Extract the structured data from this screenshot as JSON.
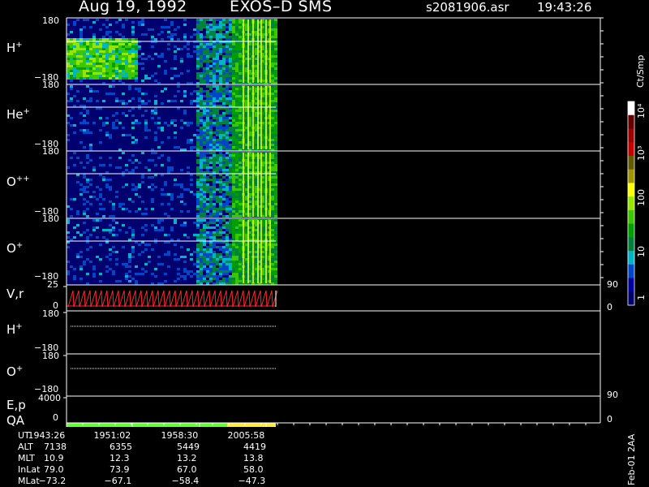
{
  "header": {
    "date": "Aug 19, 1992",
    "instrument": "EXOS–D SMS",
    "file": "s2081906.asr",
    "time": "19:43:26"
  },
  "panels": [
    {
      "label": "H",
      "charge": "+",
      "top": "180",
      "bottom": "−180"
    },
    {
      "label": "He",
      "charge": "+",
      "top": "180",
      "bottom": "−180"
    },
    {
      "label": "O",
      "charge": "++",
      "top": "180",
      "bottom": "−180"
    },
    {
      "label": "O",
      "charge": "+",
      "top": "180",
      "bottom": "−180"
    }
  ],
  "vr_panel": {
    "label": "V,r",
    "tick_top": "25",
    "tick_bottom": "0",
    "right_top": "90",
    "right_bottom": "0"
  },
  "h_line_panel": {
    "label": "H",
    "charge": "+",
    "top": "180",
    "bottom": "−180"
  },
  "o_line_panel": {
    "label": "O",
    "charge": "+",
    "top": "180",
    "bottom": "−180"
  },
  "ep_panel": {
    "label1": "E,p",
    "label2": "QA",
    "tick_top": "4000",
    "tick_bottom": "0",
    "right_top": "90",
    "right_bottom": "0"
  },
  "colorbar": {
    "units": "Ct/Smp",
    "labels": [
      "1",
      "10",
      "100",
      "10³",
      "10⁴"
    ],
    "colors": [
      "#00006e",
      "#0000a0",
      "#0046c8",
      "#00b4c8",
      "#00823c",
      "#00a000",
      "#3cc800",
      "#96e600",
      "#ffff00",
      "#a09600",
      "#645a00",
      "#c80000",
      "#a00000",
      "#640000",
      "#ffffff"
    ]
  },
  "footer": {
    "rows": [
      {
        "name": "UT",
        "values": [
          "1943:26",
          "1951:02",
          "1958:30",
          "2005:58"
        ]
      },
      {
        "name": "ALT",
        "values": [
          "7138",
          "6355",
          "5449",
          "4419"
        ]
      },
      {
        "name": "MLT",
        "values": [
          "10.9",
          "12.3",
          "13.2",
          "13.8"
        ]
      },
      {
        "name": "InLat",
        "values": [
          "79.0",
          "73.9",
          "67.0",
          "58.0"
        ]
      },
      {
        "name": "MLat",
        "values": [
          "−73.2",
          "−67.1",
          "−58.4",
          "−47.3"
        ]
      }
    ],
    "stamp": "Feb-01 2AA"
  },
  "chart_data": {
    "type": "heatmap",
    "title": "Aug 19, 1992   EXOS–D SMS",
    "x_ticks_ut": [
      "1943:26",
      "1951:02",
      "1958:30",
      "2005:58"
    ],
    "y_range": [
      -180,
      180
    ],
    "color_scale": "log",
    "color_range": [
      1,
      10000
    ],
    "series": [
      {
        "name": "H+"
      },
      {
        "name": "He+"
      },
      {
        "name": "O++"
      },
      {
        "name": "O+"
      }
    ],
    "qa_segments": [
      {
        "from": "1943:26",
        "to": "2005:58",
        "color": "#64ff32"
      },
      {
        "from": "2005:58",
        "to": "end",
        "color": "#ffeb3c"
      }
    ]
  }
}
